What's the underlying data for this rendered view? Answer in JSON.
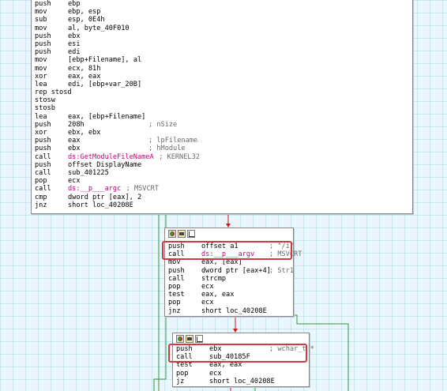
{
  "block1": {
    "lines": [
      {
        "m": "push",
        "o": "ebp",
        "c": ""
      },
      {
        "m": "mov",
        "o": "ebp, esp",
        "c": ""
      },
      {
        "m": "sub",
        "o": "esp, 0E4h",
        "c": ""
      },
      {
        "m": "mov",
        "o": "al, byte_40F010",
        "c": ""
      },
      {
        "m": "push",
        "o": "ebx",
        "c": ""
      },
      {
        "m": "push",
        "o": "esi",
        "c": ""
      },
      {
        "m": "push",
        "o": "edi",
        "c": ""
      },
      {
        "m": "mov",
        "o": "[ebp+Filename], al",
        "c": ""
      },
      {
        "m": "mov",
        "o": "ecx, 81h",
        "c": ""
      },
      {
        "m": "xor",
        "o": "eax, eax",
        "c": ""
      },
      {
        "m": "lea",
        "o": "edi, [ebp+var_20B]",
        "c": ""
      },
      {
        "m": "rep stosd",
        "o": "",
        "c": ""
      },
      {
        "m": "stosw",
        "o": "",
        "c": ""
      },
      {
        "m": "stosb",
        "o": "",
        "c": ""
      },
      {
        "m": "lea",
        "o": "eax, [ebp+Filename]",
        "c": ""
      },
      {
        "m": "push",
        "o": "208h",
        "c": "; nSize"
      },
      {
        "m": "xor",
        "o": "ebx, ebx",
        "c": ""
      },
      {
        "m": "push",
        "o": "eax",
        "c": "; lpFilename"
      },
      {
        "m": "push",
        "o": "ebx",
        "c": "; hModule"
      },
      {
        "m": "call",
        "o": "ds:GetModuleFileNameA",
        "c": "; KERNEL32"
      },
      {
        "m": "push",
        "o": "offset DisplayName",
        "c": ""
      },
      {
        "m": "call",
        "o": "sub_401225",
        "c": ""
      },
      {
        "m": "pop",
        "o": "ecx",
        "c": ""
      },
      {
        "m": "call",
        "o": "ds:__p___argc",
        "c": "; MSVCRT"
      },
      {
        "m": "cmp",
        "o": "dword ptr [eax], 2",
        "c": ""
      },
      {
        "m": "jnz",
        "o": "short loc_40208E",
        "c": ""
      }
    ]
  },
  "block2": {
    "lines": [
      {
        "m": "push",
        "o": "offset a1",
        "c": "; \"/i\""
      },
      {
        "m": "call",
        "o": "ds:__p___argv",
        "c": "; MSVCRT"
      },
      {
        "m": "mov",
        "o": "eax, [eax]",
        "c": ""
      },
      {
        "m": "push",
        "o": "dword ptr [eax+4]",
        "c": "; Str1"
      },
      {
        "m": "call",
        "o": "strcmp",
        "c": ""
      },
      {
        "m": "pop",
        "o": "ecx",
        "c": ""
      },
      {
        "m": "test",
        "o": "eax, eax",
        "c": ""
      },
      {
        "m": "pop",
        "o": "ecx",
        "c": ""
      },
      {
        "m": "jnz",
        "o": "short loc_40208E",
        "c": ""
      }
    ]
  },
  "block3": {
    "lines": [
      {
        "m": "push",
        "o": "ebx",
        "c": "; wchar_t *"
      },
      {
        "m": "call",
        "o": "sub_40185F",
        "c": ""
      },
      {
        "m": "test",
        "o": "eax, eax",
        "c": ""
      },
      {
        "m": "pop",
        "o": "ecx",
        "c": ""
      },
      {
        "m": "jz",
        "o": "short loc_40208E",
        "c": ""
      }
    ]
  },
  "colors": {
    "edge_red": "#d9161d",
    "edge_green": "#2e9a3a",
    "highlight": "#d23a43",
    "background": "#e9f6fb"
  },
  "header_icons": [
    "color-icon",
    "group-icon",
    "graph-icon"
  ]
}
